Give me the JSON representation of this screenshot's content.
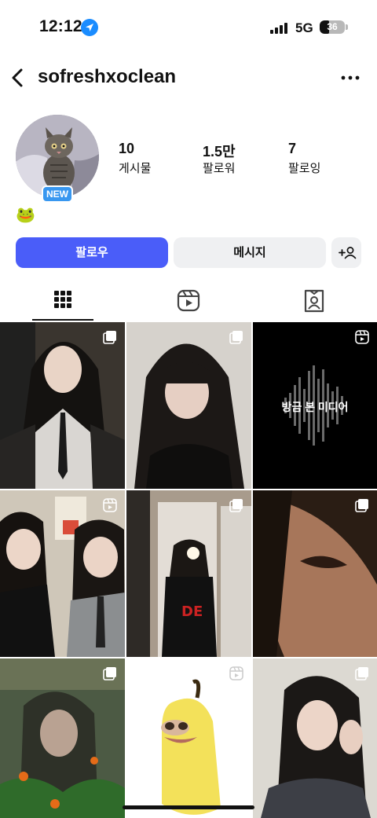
{
  "status_bar": {
    "time": "12:12",
    "network": "5G",
    "battery": "36",
    "battery_level": 0.36,
    "location_icon": "location-arrow-icon"
  },
  "nav": {
    "back_icon": "chevron-left-icon",
    "username": "sofreshxoclean",
    "more_icon": "more-horizontal-icon"
  },
  "profile": {
    "badge": "NEW",
    "bio": "🐸",
    "stats": [
      {
        "value": "10",
        "label": "게시물"
      },
      {
        "value": "1.5만",
        "label": "팔로워"
      },
      {
        "value": "7",
        "label": "팔로잉"
      }
    ]
  },
  "actions": {
    "follow": "팔로우",
    "message": "메시지",
    "add_icon": "person-add-icon"
  },
  "tabs": [
    {
      "icon": "grid-icon",
      "selected": true
    },
    {
      "icon": "reels-icon",
      "selected": false
    },
    {
      "icon": "tagged-icon",
      "selected": false
    }
  ],
  "grid": {
    "recently_viewed_label": "방금 본 미디어",
    "posts": [
      {
        "type": "carousel"
      },
      {
        "type": "carousel"
      },
      {
        "type": "reel"
      },
      {
        "type": "reel"
      },
      {
        "type": "carousel"
      },
      {
        "type": "carousel"
      },
      {
        "type": "carousel"
      },
      {
        "type": "reel"
      },
      {
        "type": "carousel"
      }
    ]
  },
  "colors": {
    "follow_button": "#4a5df9",
    "secondary_button": "#eff0f2",
    "new_badge": "#3897f0",
    "location": "#1a8cff"
  }
}
